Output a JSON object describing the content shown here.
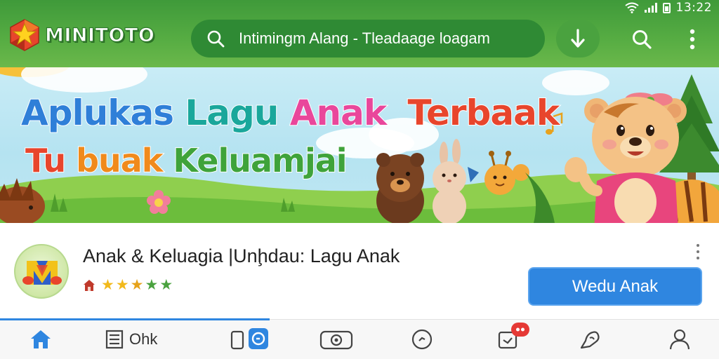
{
  "status_bar": {
    "time": "13:22"
  },
  "header": {
    "logo_text": "MINITOTO",
    "search_text": "Intimingm Alang -   Tleadaage loagam"
  },
  "banner": {
    "line1": [
      "Aplukas",
      "Lagu",
      "Anak",
      "Terbaak"
    ],
    "line2": [
      "Tu",
      "buak",
      "Keluamjai"
    ]
  },
  "app": {
    "title": "Anak & Keluagia |Unḩdau: Lagu Anak",
    "stars": [
      "★",
      "★",
      "★",
      "★",
      "★"
    ],
    "cta_label": "Wedu Anak"
  },
  "bottom_nav": {
    "items": [
      {
        "icon": "home-icon"
      },
      {
        "icon": "list-icon",
        "label": "Ohk"
      },
      {
        "icon": "phone-music-icon"
      },
      {
        "icon": "camera-icon"
      },
      {
        "icon": "clock-icon"
      },
      {
        "icon": "notification-box-icon"
      },
      {
        "icon": "hand-icon"
      },
      {
        "icon": "profile-icon"
      }
    ]
  },
  "colors": {
    "brand_green": "#4aa23f",
    "accent_blue": "#2f86e0",
    "badge_red": "#e53935"
  }
}
